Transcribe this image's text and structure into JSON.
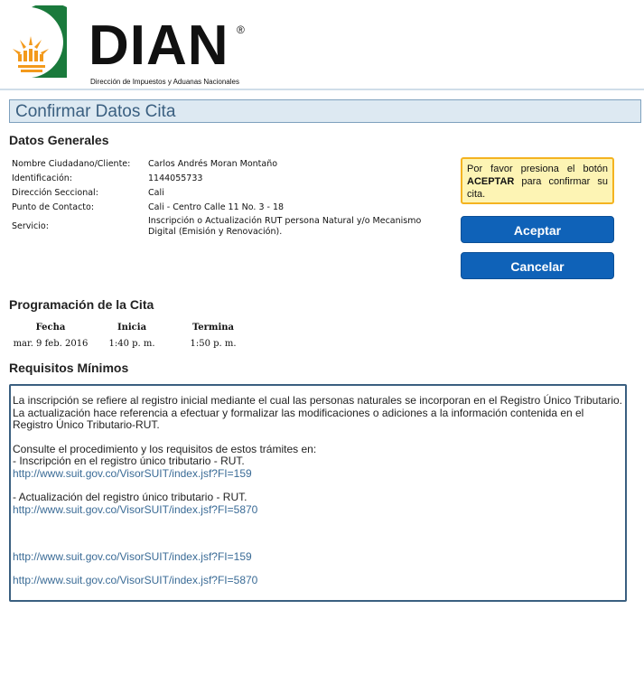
{
  "brand": {
    "name": "DIAN",
    "registered": "®",
    "subtitle": "Dirección de Impuestos y Aduanas Nacionales"
  },
  "page_title": "Confirmar Datos Cita",
  "general": {
    "heading": "Datos Generales",
    "rows": [
      {
        "label": "Nombre Ciudadano/Cliente:",
        "value": "Carlos Andrés Moran Montaño"
      },
      {
        "label": "Identificación:",
        "value": "1144055733"
      },
      {
        "label": "Dirección Seccional:",
        "value": "Cali"
      },
      {
        "label": "Punto de Contacto:",
        "value": "Cali - Centro Calle 11 No. 3 - 18"
      },
      {
        "label": "Servicio:",
        "value": "Inscripción o Actualización RUT persona Natural y/o Mecanismo Digital (Emisión y Renovación)."
      }
    ]
  },
  "notice": {
    "before": "Por favor presiona el botón ",
    "strong": "ACEPTAR",
    "after": " para confirmar su cita."
  },
  "buttons": {
    "accept": "Aceptar",
    "cancel": "Cancelar"
  },
  "schedule": {
    "heading": "Programación de la Cita",
    "headers": [
      "Fecha",
      "Inicia",
      "Termina"
    ],
    "values": [
      "mar. 9 feb. 2016",
      "1:40 p. m.",
      "1:50 p. m."
    ]
  },
  "requirements": {
    "heading": "Requisitos Mínimos",
    "intro": "La inscripción se refiere al registro inicial mediante el cual las personas naturales se incorporan en el Registro Único Tributario. La actualización hace referencia a efectuar y formalizar las modificaciones o adiciones a la información contenida en el Registro Único Tributario-RUT.",
    "consult": "Consulte el procedimiento y los requisitos de estos trámites en:",
    "item1": " -  Inscripción en el registro único tributario - RUT.",
    "link1": "http://www.suit.gov.co/VisorSUIT/index.jsf?FI=159",
    "item2": " -  Actualización del registro único tributario - RUT.",
    "link2": "http://www.suit.gov.co/VisorSUIT/index.jsf?FI=5870",
    "link3": "http://www.suit.gov.co/VisorSUIT/index.jsf?FI=159",
    "link4": "http://www.suit.gov.co/VisorSUIT/index.jsf?FI=5870"
  },
  "colors": {
    "accent_blue": "#0f62b8",
    "logo_green": "#1a7a3c",
    "logo_orange": "#f39a1c",
    "notice_bg": "#fdf4b4"
  }
}
